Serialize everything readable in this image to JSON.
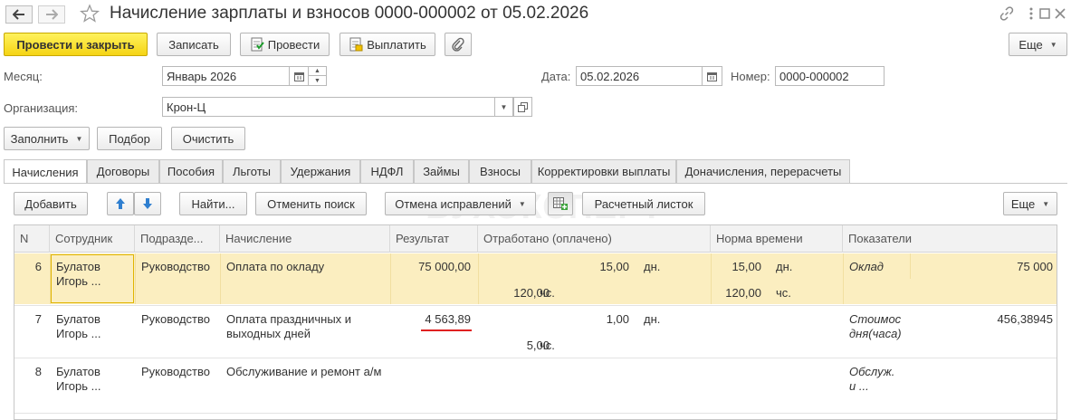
{
  "window": {
    "title": "Начисление зарплаты и взносов 0000-000002 от 05.02.2026"
  },
  "toolbar": {
    "post_close": "Провести и закрыть",
    "save": "Записать",
    "post": "Провести",
    "pay": "Выплатить",
    "more": "Еще"
  },
  "form": {
    "month_label": "Месяц:",
    "month_value": "Январь 2026",
    "date_label": "Дата:",
    "date_value": "05.02.2026",
    "number_label": "Номер:",
    "number_value": "0000-000002",
    "org_label": "Организация:",
    "org_value": "Крон-Ц",
    "fill": "Заполнить",
    "pick": "Подбор",
    "clear": "Очистить"
  },
  "tabs": [
    {
      "label": "Начисления",
      "active": true
    },
    {
      "label": "Договоры"
    },
    {
      "label": "Пособия"
    },
    {
      "label": "Льготы"
    },
    {
      "label": "Удержания"
    },
    {
      "label": "НДФЛ"
    },
    {
      "label": "Займы"
    },
    {
      "label": "Взносы"
    },
    {
      "label": "Корректировки выплаты"
    },
    {
      "label": "Доначисления, перерасчеты"
    }
  ],
  "grid_toolbar": {
    "add": "Добавить",
    "find": "Найти...",
    "cancel_search": "Отменить поиск",
    "cancel_corrections": "Отмена исправлений",
    "payslip": "Расчетный листок",
    "more": "Еще"
  },
  "watermark": "БУХЭКСПЕРТ",
  "columns": [
    "N",
    "Сотрудник",
    "Подразде...",
    "Начисление",
    "Результат",
    "Отработано (оплачено)",
    "Норма времени",
    "Показатели"
  ],
  "rows": [
    {
      "n": "6",
      "employee_1": "Булатов",
      "employee_2": "Игорь ...",
      "department": "Руководство",
      "accrual_1": "Оплата по окладу",
      "accrual_2": "",
      "result": "75 000,00",
      "worked_days": "15,00",
      "worked_days_unit": "дн.",
      "worked_hours": "120,00",
      "worked_hours_unit": "чс.",
      "norm_days": "15,00",
      "norm_days_unit": "дн.",
      "norm_hours": "120,00",
      "norm_hours_unit": "чс.",
      "indicator_1": "Оклад",
      "indicator_2": "",
      "indicator_value": "75 000",
      "selected": true
    },
    {
      "n": "7",
      "employee_1": "Булатов",
      "employee_2": "Игорь ...",
      "department": "Руководство",
      "accrual_1": "Оплата праздничных и",
      "accrual_2": "выходных дней",
      "result": "4 563,89",
      "worked_days": "1,00",
      "worked_days_unit": "дн.",
      "worked_hours": "5,00",
      "worked_hours_unit": "чс.",
      "norm_days": "",
      "norm_days_unit": "",
      "norm_hours": "",
      "norm_hours_unit": "",
      "indicator_1": "Стоимос",
      "indicator_2": "дня(часа)",
      "indicator_value": "456,38945"
    },
    {
      "n": "8",
      "employee_1": "Булатов",
      "employee_2": "Игорь ...",
      "department": "Руководство",
      "accrual_1": "Обслуживание и ремонт а/м",
      "accrual_2": "",
      "result": "",
      "worked_days": "",
      "worked_days_unit": "",
      "worked_hours": "",
      "worked_hours_unit": "",
      "norm_days": "",
      "norm_days_unit": "",
      "norm_hours": "",
      "norm_hours_unit": "",
      "indicator_1": "Обслуж.",
      "indicator_2": "и ...",
      "indicator_value": ""
    }
  ],
  "colors": {
    "primary_button": "#f5d414",
    "selected_row": "#fbeec0",
    "underline": "#e02020",
    "arrow_blue": "#2f7fd0"
  },
  "icons": [
    "back-arrow-icon",
    "forward-arrow-icon",
    "star-icon",
    "link-icon",
    "menu-dots-icon",
    "maximize-icon",
    "close-icon",
    "post-doc-icon",
    "pay-doc-icon",
    "paperclip-icon",
    "calendar-icon",
    "spin-icon",
    "dropdown-icon",
    "open-icon",
    "arrow-up-icon",
    "arrow-down-icon",
    "table-settings-icon"
  ]
}
